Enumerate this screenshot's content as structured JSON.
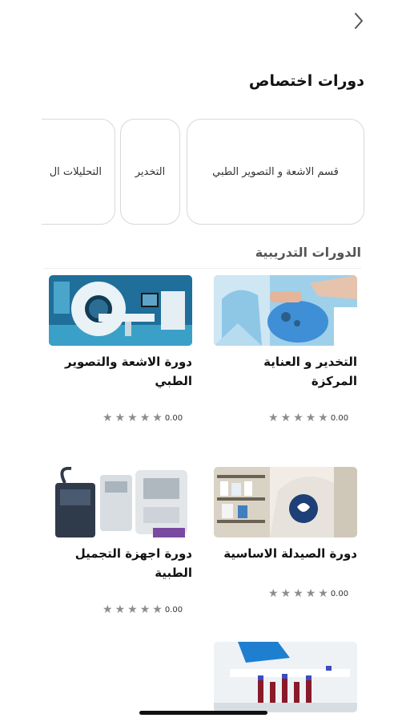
{
  "header": {
    "back_icon": "chevron-right-icon"
  },
  "specialty": {
    "title": "دورات اختصاص",
    "chips": [
      {
        "label": "قسم الاشعة و التصوير الطبي"
      },
      {
        "label": "التخدير"
      },
      {
        "label": "التحليلات ال"
      }
    ]
  },
  "training": {
    "title": "الدورات التدريبية",
    "courses": [
      {
        "title": "التخدير و العناية المركزة",
        "rating": "0.00",
        "image": "anesthesia-photo"
      },
      {
        "title": "دورة الاشعة والتصوير الطبي",
        "rating": "0.00",
        "image": "mri-scanner-photo"
      },
      {
        "title": "دورة الصيدلة الاساسية",
        "rating": "0.00",
        "image": "pharmacy-photo"
      },
      {
        "title": "دورة اجهزة التجميل الطبية",
        "rating": "0.00",
        "image": "cosmetic-devices-photo"
      },
      {
        "title": "",
        "rating": "",
        "image": "lab-tubes-photo"
      }
    ]
  }
}
